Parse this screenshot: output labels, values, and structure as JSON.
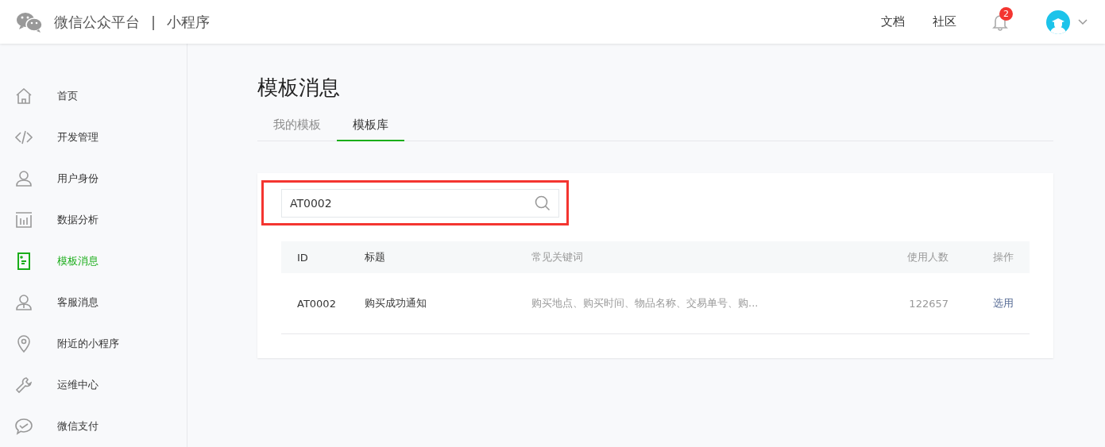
{
  "header": {
    "brand": "微信公众平台",
    "divider": "|",
    "product": "小程序",
    "links": [
      "文档",
      "社区"
    ],
    "notification_count": "2"
  },
  "sidebar": {
    "items": [
      {
        "label": "首页",
        "selected": false
      },
      {
        "label": "开发管理",
        "selected": false
      },
      {
        "label": "用户身份",
        "selected": false
      },
      {
        "label": "数据分析",
        "selected": false
      },
      {
        "label": "模板消息",
        "selected": true
      },
      {
        "label": "客服消息",
        "selected": false
      },
      {
        "label": "附近的小程序",
        "selected": false
      },
      {
        "label": "运维中心",
        "selected": false
      },
      {
        "label": "微信支付",
        "selected": false
      }
    ]
  },
  "page": {
    "title": "模板消息",
    "tabs": [
      {
        "label": "我的模板",
        "selected": false
      },
      {
        "label": "模板库",
        "selected": true
      }
    ]
  },
  "search": {
    "value": "AT0002"
  },
  "table": {
    "columns": [
      "ID",
      "标题",
      "常见关键词",
      "使用人数",
      "操作"
    ],
    "rows": [
      {
        "id": "AT0002",
        "title": "购买成功通知",
        "keywords": "购买地点、购买时间、物品名称、交易单号、购...",
        "users": "122657",
        "action": "选用"
      }
    ]
  }
}
